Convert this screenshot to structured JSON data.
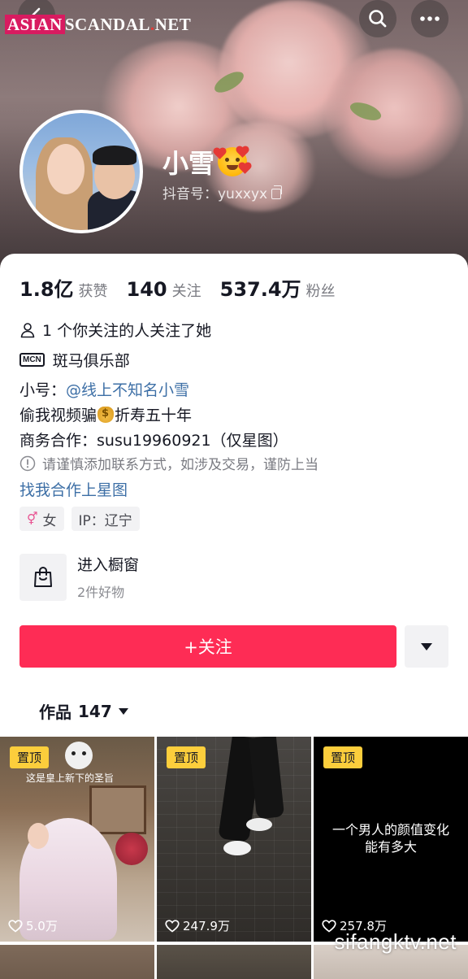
{
  "watermark_top": {
    "part1": "ASIAN",
    "part2": "SCANDAL",
    "dot": ".",
    "part3": "NET"
  },
  "profile": {
    "nickname": "小雪",
    "douyin_id": "抖音号：yuxxyx"
  },
  "stats": [
    {
      "value": "1.8亿",
      "label": "获赞"
    },
    {
      "value": "140",
      "label": "关注"
    },
    {
      "value": "537.4万",
      "label": "粉丝"
    }
  ],
  "bio": {
    "mutual": "1 个你关注的人关注了她",
    "mcn_badge": "MCN",
    "mcn": "斑马俱乐部",
    "alt_label": "小号：",
    "alt_account": "@线上不知名小雪",
    "line2_a": "偷我视频骗",
    "line2_b": "折寿五十年",
    "business": "商务合作：susu19960921（仅星图）",
    "warning": "请谨慎添加联系方式，如涉及交易，谨防上当",
    "xingtu_link": "找我合作上星图"
  },
  "tags": {
    "gender_symbol": "⚥",
    "gender": "女",
    "ip": "IP：辽宁"
  },
  "shop": {
    "title": "进入橱窗",
    "subtitle": "2件好物"
  },
  "follow_button": "+关注",
  "works_tab": {
    "label": "作品",
    "count": "147"
  },
  "videos": [
    {
      "pin": "置顶",
      "caption": "这是皇上新下的圣旨",
      "likes": "5.0万"
    },
    {
      "pin": "置顶",
      "likes": "247.9万"
    },
    {
      "pin": "置顶",
      "text_line1": "一个男人的颜值变化",
      "text_line2": "能有多大",
      "likes": "257.8万"
    }
  ],
  "watermark_bottom": "sifangktv.net",
  "colors": {
    "accent": "#fe2c55",
    "pin": "#fcce3c",
    "link": "#3d6fa6"
  },
  "icons": {
    "back": "back-icon",
    "search": "search-icon",
    "more": "more-icon",
    "copy": "copy-icon",
    "person": "person-icon",
    "warning": "warning-icon",
    "shop": "shopping-bag-icon",
    "dropdown": "caret-down-icon",
    "heart": "heart-outline-icon"
  }
}
